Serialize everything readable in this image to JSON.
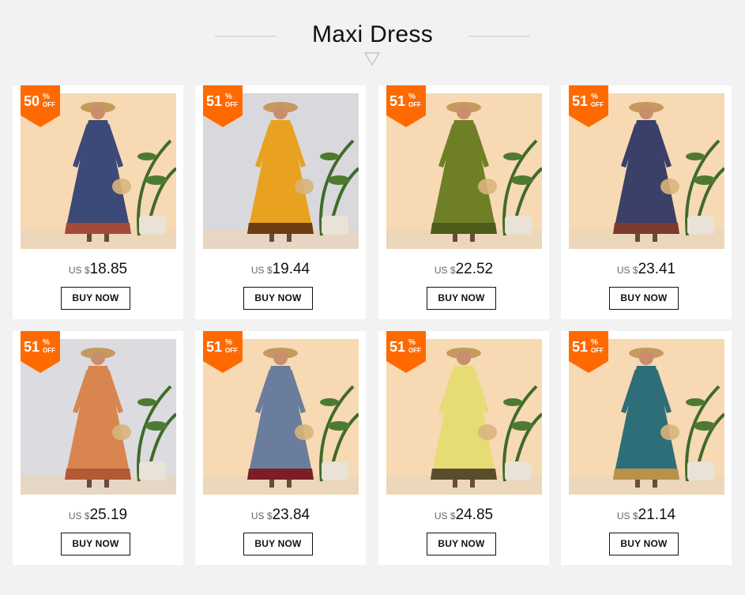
{
  "section_title": "Maxi Dress",
  "badge_percent_sign": "%",
  "badge_off_label": "OFF",
  "currency_label": "US $",
  "buy_label": "BUY NOW",
  "colors": {
    "badge": "#ff6a00",
    "page_bg": "#f2f2f2"
  },
  "products": [
    {
      "discount": "50",
      "price": "18.85",
      "bg": "#f7d9b4",
      "dress": "#3c4a78",
      "hem": "#a34a3a"
    },
    {
      "discount": "51",
      "price": "19.44",
      "bg": "#d9d8dc",
      "dress": "#e8a21f",
      "hem": "#6b3d12"
    },
    {
      "discount": "51",
      "price": "22.52",
      "bg": "#f7d9b4",
      "dress": "#6f7f25",
      "hem": "#4e5c19"
    },
    {
      "discount": "51",
      "price": "23.41",
      "bg": "#f7d9b4",
      "dress": "#3b4068",
      "hem": "#7c3a2f"
    },
    {
      "discount": "51",
      "price": "25.19",
      "bg": "#dcdbe0",
      "dress": "#d98550",
      "hem": "#b25a33"
    },
    {
      "discount": "51",
      "price": "23.84",
      "bg": "#f7d9b4",
      "dress": "#6a7d9c",
      "hem": "#7a1f24"
    },
    {
      "discount": "51",
      "price": "24.85",
      "bg": "#f7d9b4",
      "dress": "#e5dc74",
      "hem": "#5a4c2c"
    },
    {
      "discount": "51",
      "price": "21.14",
      "bg": "#f7d9b4",
      "dress": "#2e6e78",
      "hem": "#b8924a"
    }
  ]
}
